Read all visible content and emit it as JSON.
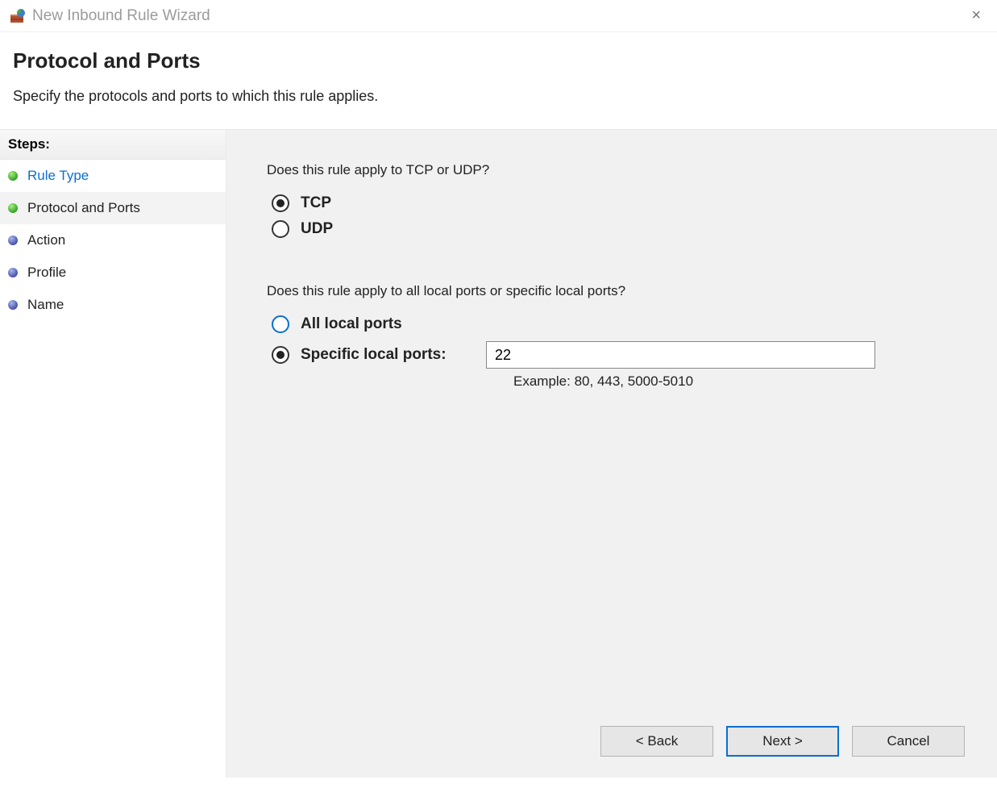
{
  "window": {
    "title": "New Inbound Rule Wizard",
    "close_icon": "×"
  },
  "header": {
    "page_title": "Protocol and Ports",
    "subtitle": "Specify the protocols and ports to which this rule applies."
  },
  "sidebar": {
    "steps_header": "Steps:",
    "items": [
      {
        "label": "Rule Type",
        "status": "completed"
      },
      {
        "label": "Protocol and Ports",
        "status": "current"
      },
      {
        "label": "Action",
        "status": "pending"
      },
      {
        "label": "Profile",
        "status": "pending"
      },
      {
        "label": "Name",
        "status": "pending"
      }
    ]
  },
  "content": {
    "protocol_question": "Does this rule apply to TCP or UDP?",
    "tcp_label": "TCP",
    "udp_label": "UDP",
    "protocol_selected": "TCP",
    "ports_question": "Does this rule apply to all local ports or specific local ports?",
    "all_ports_label": "All local ports",
    "specific_ports_label": "Specific local ports:",
    "ports_selected": "specific",
    "port_value": "22",
    "example_text": "Example: 80, 443, 5000-5010"
  },
  "buttons": {
    "back": "< Back",
    "next": "Next >",
    "cancel": "Cancel"
  }
}
